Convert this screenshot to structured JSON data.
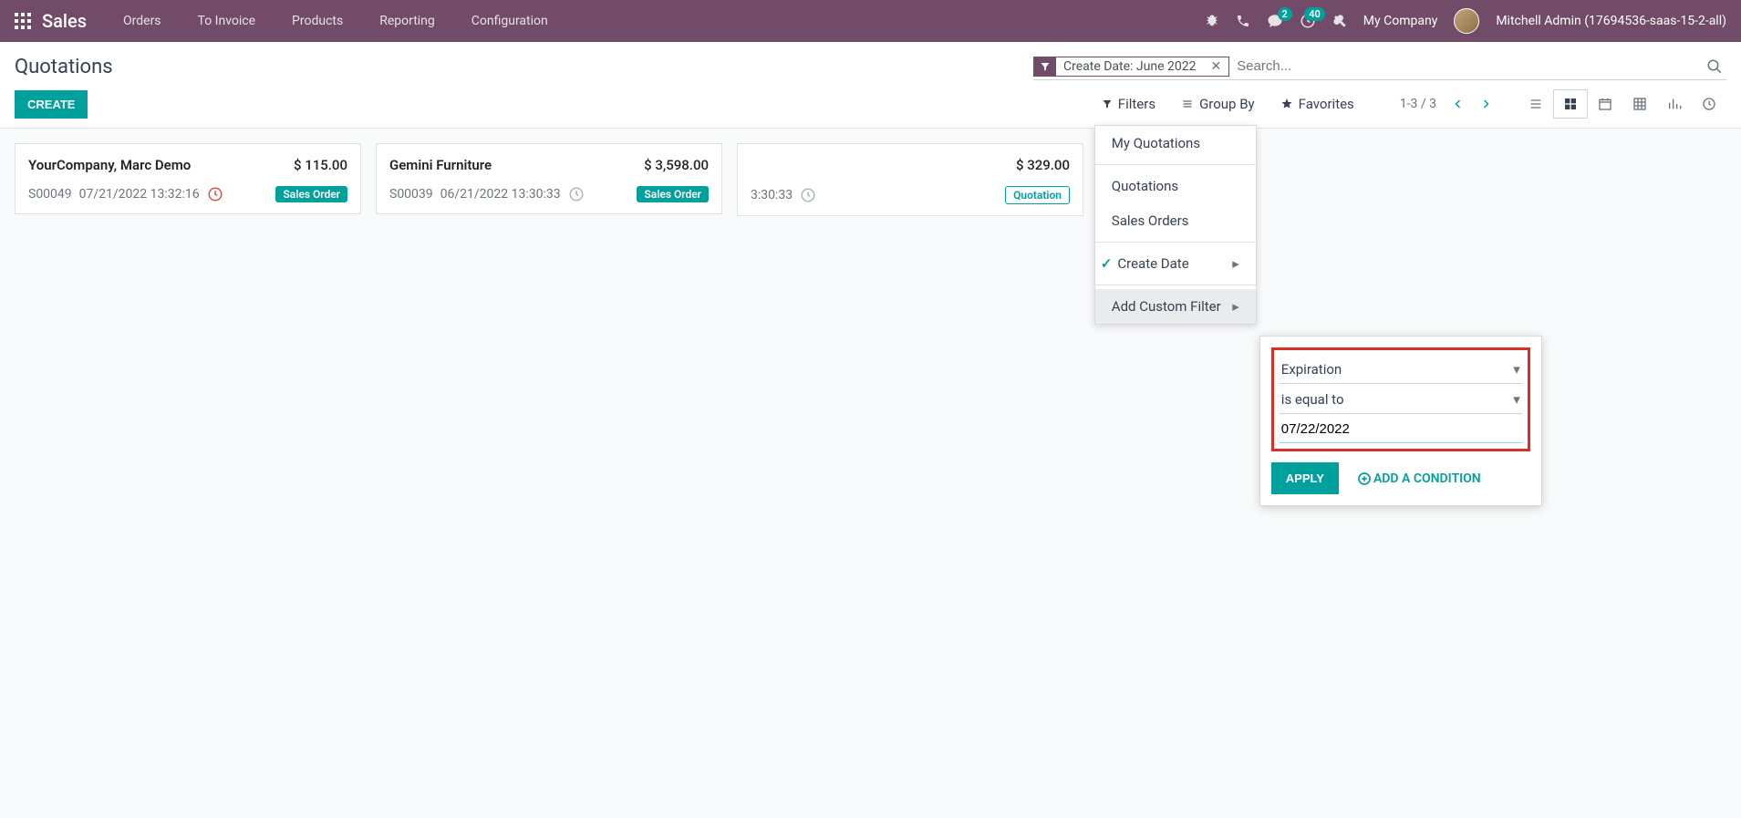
{
  "topnav": {
    "brand": "Sales",
    "menu": [
      "Orders",
      "To Invoice",
      "Products",
      "Reporting",
      "Configuration"
    ],
    "badges": {
      "chat": "2",
      "activities": "40"
    },
    "company": "My Company",
    "user": "Mitchell Admin (17694536-saas-15-2-all)"
  },
  "breadcrumb": "Quotations",
  "create_label": "CREATE",
  "search": {
    "facet_label": "Create Date: June 2022",
    "placeholder": "Search..."
  },
  "search_options": {
    "filters_label": "Filters",
    "groupby_label": "Group By",
    "favorites_label": "Favorites"
  },
  "pager": "1-3 / 3",
  "filters_dropdown": {
    "items": [
      "My Quotations",
      "Quotations",
      "Sales Orders"
    ],
    "create_date": "Create Date",
    "add_custom": "Add Custom Filter"
  },
  "custom_filter": {
    "field": "Expiration",
    "operator": "is equal to",
    "value": "07/22/2022",
    "apply": "APPLY",
    "add_condition": "ADD A CONDITION"
  },
  "cards": [
    {
      "title": "YourCompany, Marc Demo",
      "amount": "$ 115.00",
      "ref": "S00049",
      "date": "07/21/2022 13:32:16",
      "clock": "red",
      "tag": "Sales Order",
      "tag_style": "filled"
    },
    {
      "title": "Gemini Furniture",
      "amount": "$ 3,598.00",
      "ref": "S00039",
      "date": "06/21/2022 13:30:33",
      "clock": "grey",
      "tag": "Sales Order",
      "tag_style": "filled"
    },
    {
      "title": "",
      "amount": "$ 329.00",
      "ref": "",
      "date": "3:30:33",
      "clock": "grey",
      "tag": "Quotation",
      "tag_style": "outline"
    }
  ]
}
